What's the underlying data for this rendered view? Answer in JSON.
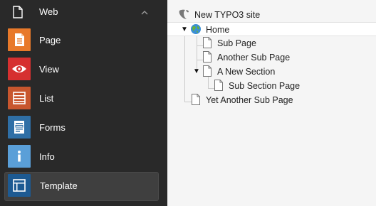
{
  "sidebar": {
    "group": {
      "label": "Web",
      "icon": "page-icon",
      "toggle_icon": "chevron-up-icon"
    },
    "modules": [
      {
        "label": "Page",
        "icon": "page-module-icon",
        "color": "#e8792a",
        "active": false
      },
      {
        "label": "View",
        "icon": "eye-icon",
        "color": "#d63030",
        "active": false
      },
      {
        "label": "List",
        "icon": "list-icon",
        "color": "#c8562e",
        "active": false
      },
      {
        "label": "Forms",
        "icon": "form-icon",
        "color": "#2f6fa6",
        "active": false
      },
      {
        "label": "Info",
        "icon": "info-icon",
        "color": "#5a9fd8",
        "active": false
      },
      {
        "label": "Template",
        "icon": "template-icon",
        "color": "#1d5a92",
        "active": true
      }
    ]
  },
  "tree": {
    "root": {
      "label": "New TYPO3 site",
      "icon": "typo3-logo-icon"
    },
    "nodes": [
      {
        "label": "Home",
        "icon": "globe-icon",
        "expanded": true,
        "selected": true
      },
      {
        "label": "Sub Page",
        "icon": "page-icon"
      },
      {
        "label": "Another Sub Page",
        "icon": "page-icon"
      },
      {
        "label": "A New Section",
        "icon": "page-icon",
        "expanded": true
      },
      {
        "label": "Sub Section Page",
        "icon": "page-icon"
      },
      {
        "label": "Yet Another Sub Page",
        "icon": "page-icon"
      }
    ]
  }
}
